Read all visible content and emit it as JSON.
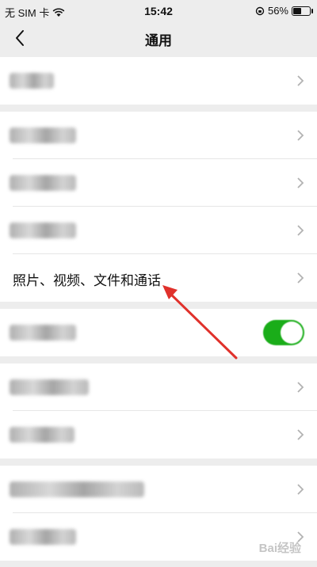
{
  "status_bar": {
    "carrier": "无 SIM 卡",
    "time": "15:42",
    "battery_percent_text": "56%",
    "battery_level": 0.56
  },
  "nav": {
    "title": "通用",
    "back_icon": "chevron-left-icon"
  },
  "rows": {
    "photos_videos_files_calls": {
      "label": "照片、视频、文件和通话"
    }
  },
  "toggle": {
    "state": "on",
    "color": "#1aad19"
  },
  "annotation": {
    "arrow_color": "#e0312b"
  },
  "watermark": {
    "text": "Bai经验"
  }
}
